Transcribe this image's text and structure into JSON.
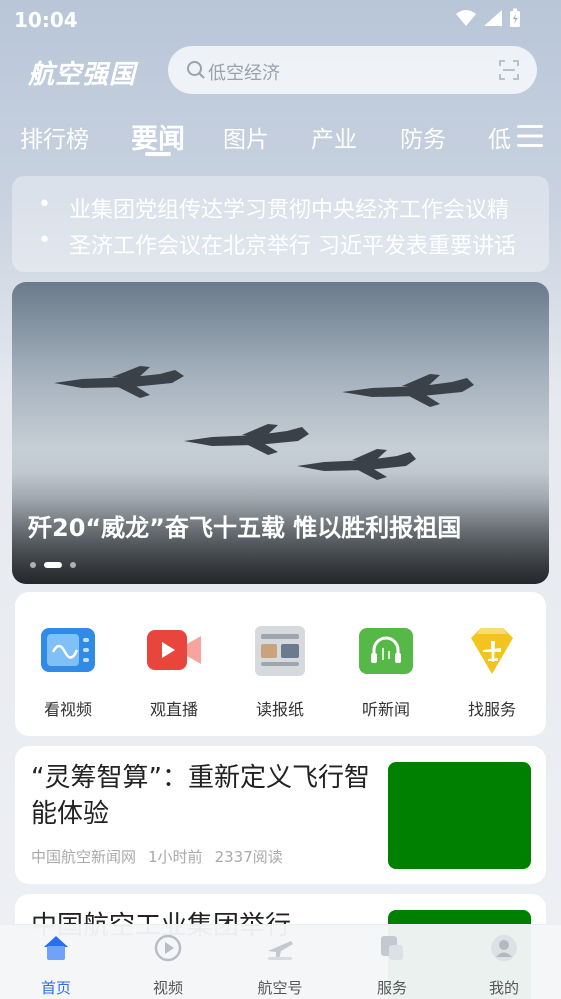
{
  "status_bar": {
    "time": "10:04"
  },
  "header": {
    "logo_text": "航空强国",
    "search_placeholder": "低空经济"
  },
  "tabs": [
    {
      "label": "排行榜",
      "active": false
    },
    {
      "label": "要闻",
      "active": true
    },
    {
      "label": "图片",
      "active": false
    },
    {
      "label": "产业",
      "active": false
    },
    {
      "label": "防务",
      "active": false
    },
    {
      "label": "低",
      "active": false
    }
  ],
  "ticker": [
    "业集团党组传达学习贯彻中央经济工作会议精",
    "圣济工作会议在北京举行 习近平发表重要讲话"
  ],
  "banner": {
    "title": "歼20“威龙”奋飞十五载 惟以胜利报祖国",
    "slide_count": 3,
    "active_slide": 2
  },
  "quick_links": [
    {
      "label": "看视频",
      "icon": "video-icon"
    },
    {
      "label": "观直播",
      "icon": "live-icon"
    },
    {
      "label": "读报纸",
      "icon": "newspaper-icon"
    },
    {
      "label": "听新闻",
      "icon": "audio-news-icon"
    },
    {
      "label": "找服务",
      "icon": "service-icon"
    }
  ],
  "news": [
    {
      "title": "“灵筹智算”：重新定义飞行智能体验",
      "source": "中国航空新闻网",
      "time": "1小时前",
      "reads": "2337阅读",
      "thumb_color": "#008000"
    },
    {
      "title": "中国航空工业集团举行",
      "source": "",
      "time": "",
      "reads": "",
      "thumb_color": "#008000"
    }
  ],
  "bottom_nav": [
    {
      "label": "首页",
      "active": true,
      "icon": "home-icon"
    },
    {
      "label": "视频",
      "active": false,
      "icon": "play-icon"
    },
    {
      "label": "航空号",
      "active": false,
      "icon": "plane-icon"
    },
    {
      "label": "服务",
      "active": false,
      "icon": "service-grid-icon"
    },
    {
      "label": "我的",
      "active": false,
      "icon": "profile-icon"
    }
  ],
  "colors": {
    "accent": "#2a6ef0",
    "thumb": "#008000",
    "live_red": "#e8453c",
    "audio_green": "#56b847",
    "service_yellow": "#f3c41d"
  }
}
